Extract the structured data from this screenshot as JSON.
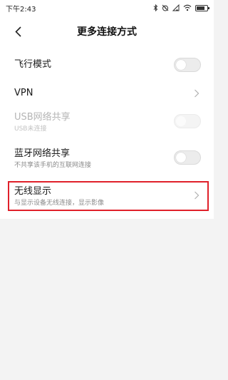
{
  "status_bar": {
    "time": "下午2:43",
    "icons": [
      "bluetooth-icon",
      "alarm-icon",
      "signal-icon",
      "wifi-icon",
      "battery-icon"
    ],
    "battery_level": 0.8
  },
  "header": {
    "back_icon": "chevron-left-icon",
    "title": "更多连接方式"
  },
  "settings": {
    "items": [
      {
        "title": "飞行模式",
        "control": "toggle",
        "checked": false,
        "enabled": true
      },
      {
        "title": "VPN",
        "control": "chevron",
        "enabled": true
      },
      {
        "title": "USB网络共享",
        "subtitle": "USB未连接",
        "control": "toggle",
        "checked": false,
        "enabled": false
      },
      {
        "title": "蓝牙网络共享",
        "subtitle": "不共享该手机的互联网连接",
        "control": "toggle",
        "checked": false,
        "enabled": true
      },
      {
        "title": "无线显示",
        "subtitle": "与显示设备无线连接，显示影像",
        "control": "chevron",
        "enabled": true,
        "highlighted": true
      }
    ]
  },
  "colors": {
    "highlight": "#e0202a",
    "background": "#f3f3f3",
    "card": "#ffffff"
  }
}
